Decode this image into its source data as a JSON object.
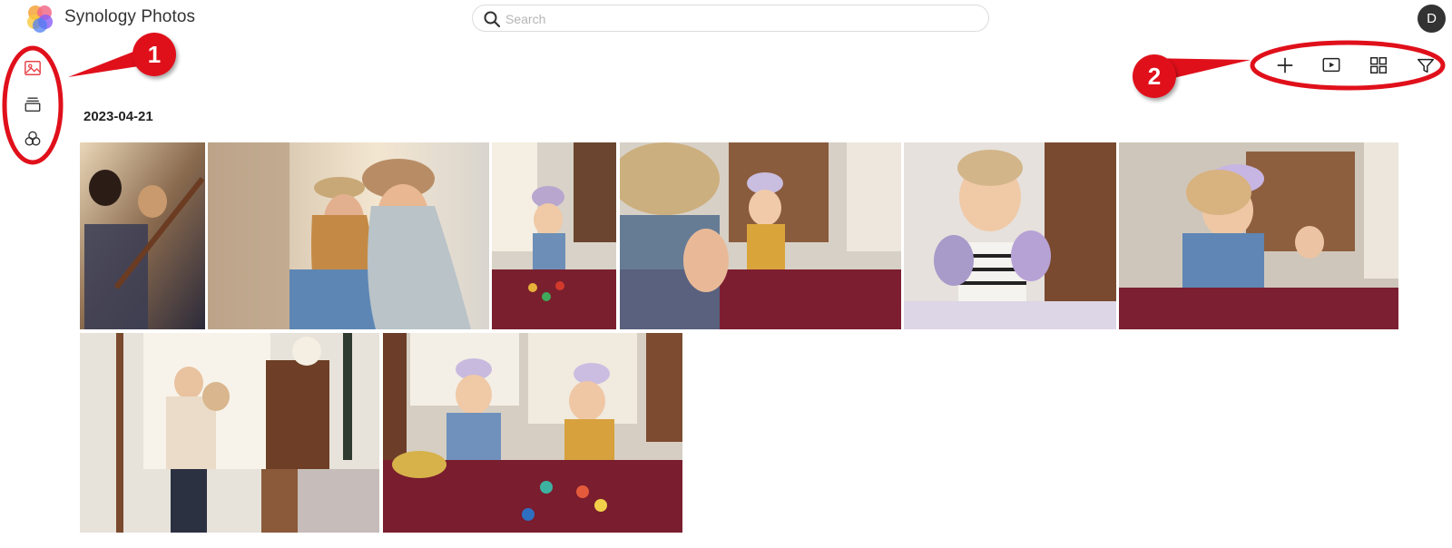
{
  "header": {
    "app_title": "Synology Photos",
    "search_placeholder": "Search",
    "search_value": "",
    "avatar_initial": "D"
  },
  "sidebar": {
    "items": [
      {
        "icon": "photos-icon",
        "active": true,
        "color": "#e8444a"
      },
      {
        "icon": "albums-icon",
        "active": false
      },
      {
        "icon": "shared-space-icon",
        "active": false
      }
    ]
  },
  "toolbar": {
    "icons": [
      "add-icon",
      "slideshow-icon",
      "grid-view-icon",
      "filter-icon"
    ]
  },
  "timeline": {
    "date": "2023-04-21",
    "photos": [
      {
        "subject": "friends playing guitar"
      },
      {
        "subject": "two women taking a selfie"
      },
      {
        "subject": "toddler with crown playing with toys"
      },
      {
        "subject": "children wearing crowns playing"
      },
      {
        "subject": "girl with painted hands"
      },
      {
        "subject": "girl with crown playing with toys"
      },
      {
        "subject": "father carrying two children"
      },
      {
        "subject": "two toddlers with crowns playing on rug"
      }
    ]
  },
  "annotations": {
    "badge_1": "1",
    "badge_2": "2",
    "color": "#e0101b"
  }
}
